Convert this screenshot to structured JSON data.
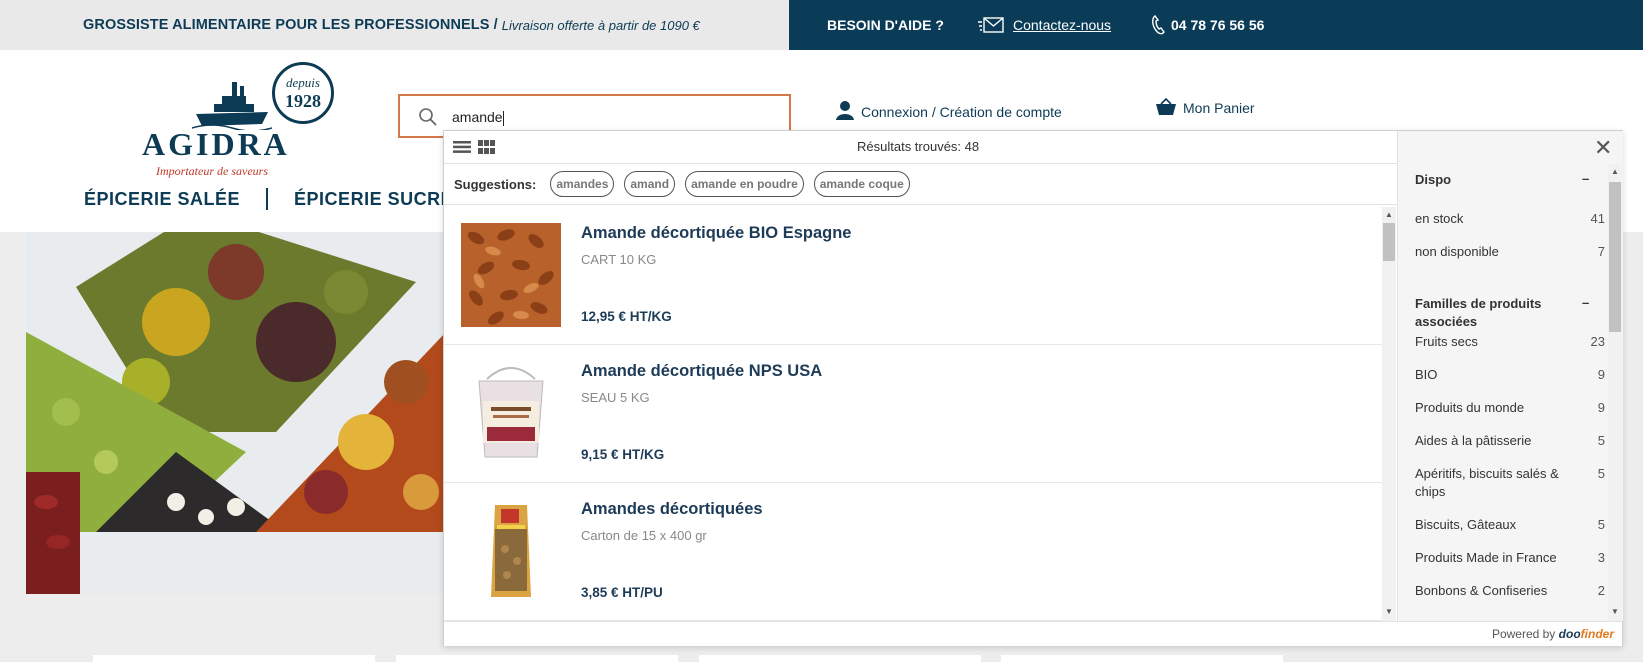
{
  "topbar": {
    "tagline": "GROSSISTE ALIMENTAIRE POUR LES PROFESSIONNELS /",
    "delivery": "Livraison offerte à partir de 1090 €",
    "help": "BESOIN D'AIDE ?",
    "contact": "Contactez-nous",
    "phone": "04 78 76 56 56"
  },
  "logo": {
    "name": "AGIDRA",
    "subtitle": "Importateur de saveurs",
    "badge_top": "depuis",
    "badge_year": "1928"
  },
  "search": {
    "query": "amande"
  },
  "account": {
    "login": "Connexion / Création de compte",
    "cart": "Mon Panier"
  },
  "nav": {
    "items": [
      "ÉPICERIE SALÉE",
      "ÉPICERIE SUCRÉE"
    ]
  },
  "dropdown": {
    "results": "Résultats trouvés: 48",
    "suggestions_label": "Suggestions:",
    "suggestions": [
      "amandes",
      "amand",
      "amande en poudre",
      "amande coque"
    ],
    "products": [
      {
        "title": "Amande décortiquée BIO Espagne",
        "subtitle": "CART 10 KG",
        "price": "12,95 € HT/KG"
      },
      {
        "title": "Amande décortiquée NPS USA",
        "subtitle": "SEAU 5 KG",
        "price": "9,15 € HT/KG"
      },
      {
        "title": "Amandes décortiquées",
        "subtitle": "Carton de 15 x 400 gr",
        "price": "3,85 € HT/PU"
      }
    ],
    "facets": {
      "dispo_title": "Dispo",
      "dispo_toggle": "–",
      "dispo": [
        {
          "label": "en stock",
          "count": "41"
        },
        {
          "label": "non disponible",
          "count": "7"
        }
      ],
      "families_title": "Familles de produits associées",
      "families_toggle": "–",
      "families": [
        {
          "label": "Fruits secs",
          "count": "23"
        },
        {
          "label": "BIO",
          "count": "9"
        },
        {
          "label": "Produits du monde",
          "count": "9"
        },
        {
          "label": "Aides à la pâtisserie",
          "count": "5"
        },
        {
          "label": "Apéritifs, biscuits salés & chips",
          "count": "5"
        },
        {
          "label": "Biscuits, Gâteaux",
          "count": "5"
        },
        {
          "label": "Produits Made in France",
          "count": "3"
        },
        {
          "label": "Bonbons & Confiseries",
          "count": "2"
        }
      ]
    },
    "powered_by": "Powered by",
    "powered_brand_a": "doo",
    "powered_brand_b": "finder"
  },
  "colors": {
    "navy": "#0b3c57",
    "search_border": "#d37848",
    "brand_orange": "#e07a1d"
  }
}
